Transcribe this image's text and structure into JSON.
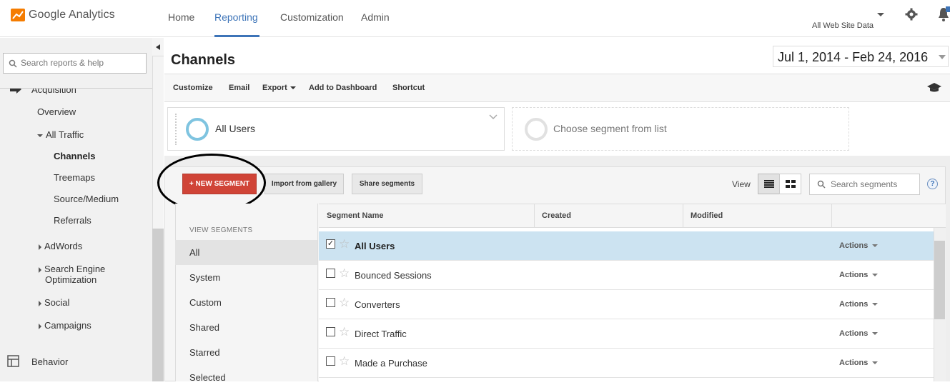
{
  "app": {
    "brand": "Google Analytics",
    "nav": [
      "Home",
      "Reporting",
      "Customization",
      "Admin"
    ],
    "active_nav": "Reporting",
    "account": "All Web Site Data"
  },
  "sidebar": {
    "search_placeholder": "Search reports & help",
    "acquisition": "Acquisition",
    "overview": "Overview",
    "all_traffic": "All Traffic",
    "channels": "Channels",
    "treemaps": "Treemaps",
    "source_medium": "Source/Medium",
    "referrals": "Referrals",
    "adwords": "AdWords",
    "seo_line1": "Search Engine",
    "seo_line2": "Optimization",
    "social": "Social",
    "campaigns": "Campaigns",
    "behavior": "Behavior"
  },
  "page": {
    "title": "Channels",
    "date_range": "Jul 1, 2014 - Feb 24, 2016"
  },
  "toolbar": {
    "customize": "Customize",
    "email": "Email",
    "export": "Export",
    "add_to_dashboard": "Add to Dashboard",
    "shortcut": "Shortcut"
  },
  "segments_bar": {
    "selected": "All Users",
    "choose": "Choose segment from list"
  },
  "segment_panel": {
    "new_segment": "+ NEW SEGMENT",
    "import": "Import from gallery",
    "share": "Share segments",
    "view_label": "View",
    "search_placeholder": "Search segments",
    "help": "?",
    "view_segments_header": "VIEW SEGMENTS",
    "filters": [
      "All",
      "System",
      "Custom",
      "Shared",
      "Starred",
      "Selected"
    ],
    "active_filter": "All",
    "columns": [
      "Segment Name",
      "Created",
      "Modified"
    ],
    "actions_label": "Actions",
    "rows": [
      {
        "name": "All Users",
        "checked": true,
        "selected": true
      },
      {
        "name": "Bounced Sessions",
        "checked": false,
        "selected": false
      },
      {
        "name": "Converters",
        "checked": false,
        "selected": false
      },
      {
        "name": "Direct Traffic",
        "checked": false,
        "selected": false
      },
      {
        "name": "Made a Purchase",
        "checked": false,
        "selected": false
      }
    ]
  },
  "colors": {
    "accent_blue": "#3d74b8",
    "new_segment_red": "#d04437",
    "selected_row": "#cce3f1",
    "annotation_oval": "#000000"
  }
}
